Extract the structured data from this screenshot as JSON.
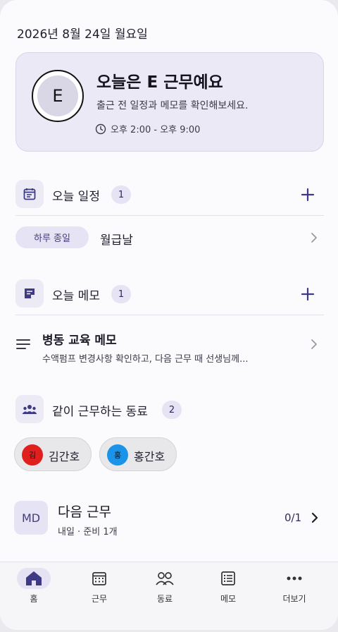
{
  "header": {
    "date": "2026년 8월 24일 월요일"
  },
  "hero": {
    "avatar_letter": "E",
    "title": "오늘은 E 근무예요",
    "subtitle": "출근 전 일정과 메모를 확인해보세요.",
    "time": "오후 2:00 - 오후 9:00"
  },
  "schedule": {
    "title": "오늘 일정",
    "count": "1",
    "icon": "calendar-icon",
    "item": {
      "tag": "하루 종일",
      "title": "월급날"
    }
  },
  "memo": {
    "title": "오늘 메모",
    "count": "1",
    "icon": "memo-icon",
    "item": {
      "title": "병동 교육 메모",
      "preview": "수액펌프 변경사항 확인하고, 다음 근무 때 선생님께..."
    }
  },
  "coworkers": {
    "title": "같이 근무하는 동료",
    "count": "2",
    "icon": "group-icon",
    "people": [
      {
        "initial": "김",
        "name": "김간호",
        "color": "#e0201f"
      },
      {
        "initial": "홍",
        "name": "홍간호",
        "color": "#1a93e8"
      }
    ]
  },
  "next_shift": {
    "badge": "MD",
    "title": "다음 근무",
    "subtitle": "내일 · 준비 1개",
    "progress": "0/1"
  },
  "nav": [
    {
      "label": "홈",
      "icon": "home-icon",
      "active": true
    },
    {
      "label": "근무",
      "icon": "calendar-grid-icon",
      "active": false
    },
    {
      "label": "동료",
      "icon": "people-icon",
      "active": false
    },
    {
      "label": "메모",
      "icon": "list-icon",
      "active": false
    },
    {
      "label": "더보기",
      "icon": "more-icon",
      "active": false
    }
  ],
  "colors": {
    "accent": "#3f3a86",
    "accent_soft": "#e6e4f4",
    "hero_bg": "#ece9f6"
  }
}
